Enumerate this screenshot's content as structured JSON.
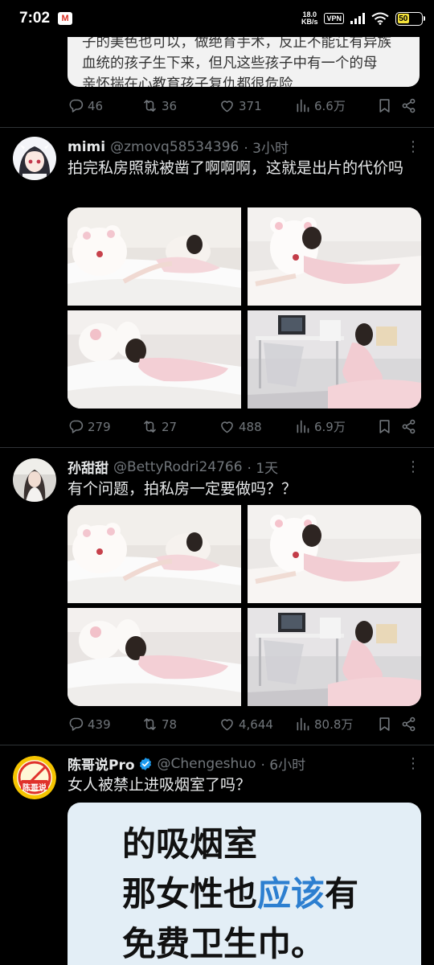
{
  "status_bar": {
    "time": "7:02",
    "gmail_badge": "M",
    "net_speed_value": "18.0",
    "net_speed_unit": "KB/s",
    "vpn_label": "VPN",
    "battery_percent": "50",
    "battery_level": 0.5,
    "battery_color": "#f5e33a"
  },
  "tweet0": {
    "quote_text_line1": "子的美色也可以，做绝育手术，反正不能让有异族",
    "quote_text_line2": "血统的孩子生下来，但凡这些孩子中有一个的母",
    "quote_text_line3": "亲怀揣在心教育孩子复仇都很危险",
    "reply_count": "46",
    "retweet_count": "36",
    "like_count": "371",
    "view_count": "6.6万"
  },
  "tweet1": {
    "name": "mimi",
    "handle": "@zmovq58534396",
    "time": "· 3小时",
    "text": "拍完私房照就被凿了啊啊啊，这就是出片的代价吗",
    "reply_count": "279",
    "retweet_count": "27",
    "like_count": "488",
    "view_count": "6.9万"
  },
  "tweet2": {
    "name": "孙甜甜",
    "handle": "@BettyRodri24766",
    "time": "· 1天",
    "text": "有个问题，拍私房一定要做吗？？",
    "reply_count": "439",
    "retweet_count": "78",
    "like_count": "4,644",
    "view_count": "80.8万"
  },
  "tweet3": {
    "name": "陈哥说Pro",
    "handle": "@Chengeshuo",
    "time": "· 6小时",
    "text": "女人被禁止进吸烟室了吗？",
    "avatar_text": "陈哥说",
    "poster_line1": "的吸烟室",
    "poster_line2_a": "那女性也",
    "poster_line2_b": "应该",
    "poster_line2_c": "有",
    "poster_line3": "免费卫生巾。"
  },
  "colors": {
    "background": "#000000",
    "text": "#e7e9ea",
    "secondary_text": "#71767b",
    "divider": "#2f3336",
    "verified_blue": "#1d9bf0",
    "poster_highlight": "#2d7fd0"
  },
  "icons": [
    "reply-icon",
    "retweet-icon",
    "like-icon",
    "views-icon",
    "bookmark-icon",
    "share-icon",
    "more-icon",
    "verified-icon",
    "wifi-icon",
    "signal-icon",
    "battery-icon"
  ]
}
